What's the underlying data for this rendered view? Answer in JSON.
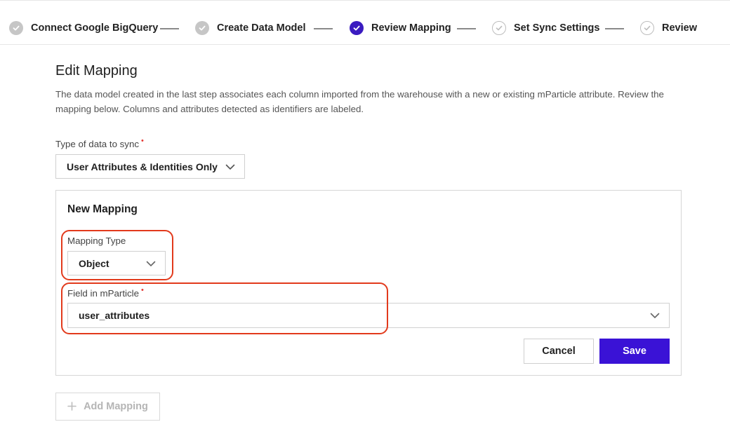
{
  "steps": [
    {
      "label": "Connect Google BigQuery",
      "state": "done"
    },
    {
      "label": "Create Data Model",
      "state": "done"
    },
    {
      "label": "Review Mapping",
      "state": "active"
    },
    {
      "label": "Set Sync Settings",
      "state": "todo"
    },
    {
      "label": "Review",
      "state": "todo"
    }
  ],
  "page": {
    "title": "Edit Mapping",
    "description": "The data model created in the last step associates each column imported from the warehouse with a new or existing mParticle attribute. Review the mapping below. Columns and attributes detected as identifiers are labeled."
  },
  "sync_type": {
    "label": "Type of data to sync",
    "required_marker": "•",
    "value": "User Attributes & Identities Only"
  },
  "new_mapping": {
    "title": "New Mapping",
    "mapping_type": {
      "label": "Mapping Type",
      "value": "Object"
    },
    "field": {
      "label": "Field in mParticle",
      "required_marker": "•",
      "value": "user_attributes"
    },
    "cancel_label": "Cancel",
    "save_label": "Save"
  },
  "add_mapping": {
    "icon": "plus-icon",
    "label": "Add Mapping"
  },
  "colors": {
    "accent": "#3a12d6",
    "active_step": "#3a1bc0",
    "highlight": "#e23a1c",
    "required": "#e53935"
  }
}
